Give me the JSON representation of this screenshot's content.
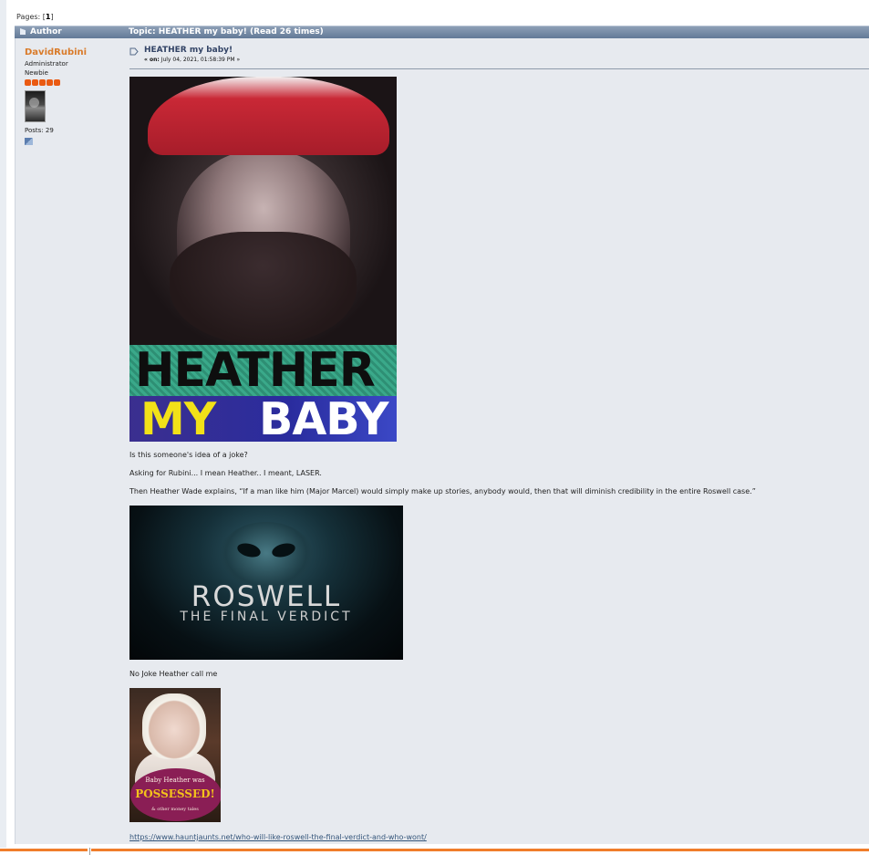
{
  "pagination": {
    "label": "Pages: [",
    "current": "1",
    "close": "]"
  },
  "header": {
    "author_label": "Author",
    "topic_label": "Topic: HEATHER my baby!  (Read 26 times)"
  },
  "poster": {
    "name": "DavidRubini",
    "role": "Administrator",
    "rank": "Newbie",
    "stars": 5,
    "posts": "Posts: 29"
  },
  "post": {
    "subject": "HEATHER my baby!",
    "date_prefix": "« on:",
    "date": " July 04, 2021, 01:58:39 PM »",
    "image1": {
      "line1": "HEATHER",
      "line2a": "MY",
      "line2b": "BABY"
    },
    "p1": "Is this someone's idea of a joke?",
    "p2": "Asking for Rubini... I mean Heather.. I meant, LASER.",
    "p3": "Then Heather Wade explains, “If a man like him (Major Marcel)  would simply make up stories, anybody would, then that will diminish credibility in the entire Roswell case.”",
    "image2": {
      "title": "ROSWELL",
      "subtitle": "THE FINAL VERDICT"
    },
    "p4": "No Joke Heather call me",
    "image3": {
      "line1": "Baby Heather was",
      "line2": "POSSESSED!",
      "line3": "& other money tales"
    },
    "link": "https://www.hauntjaunts.net/who-will-like-roswell-the-final-verdict-and-who-wont/"
  },
  "colors": {
    "accent": "#f07d2a",
    "poster_name": "#d97b2a",
    "star": "#ea5a12",
    "header_bar": "#6e849f"
  }
}
